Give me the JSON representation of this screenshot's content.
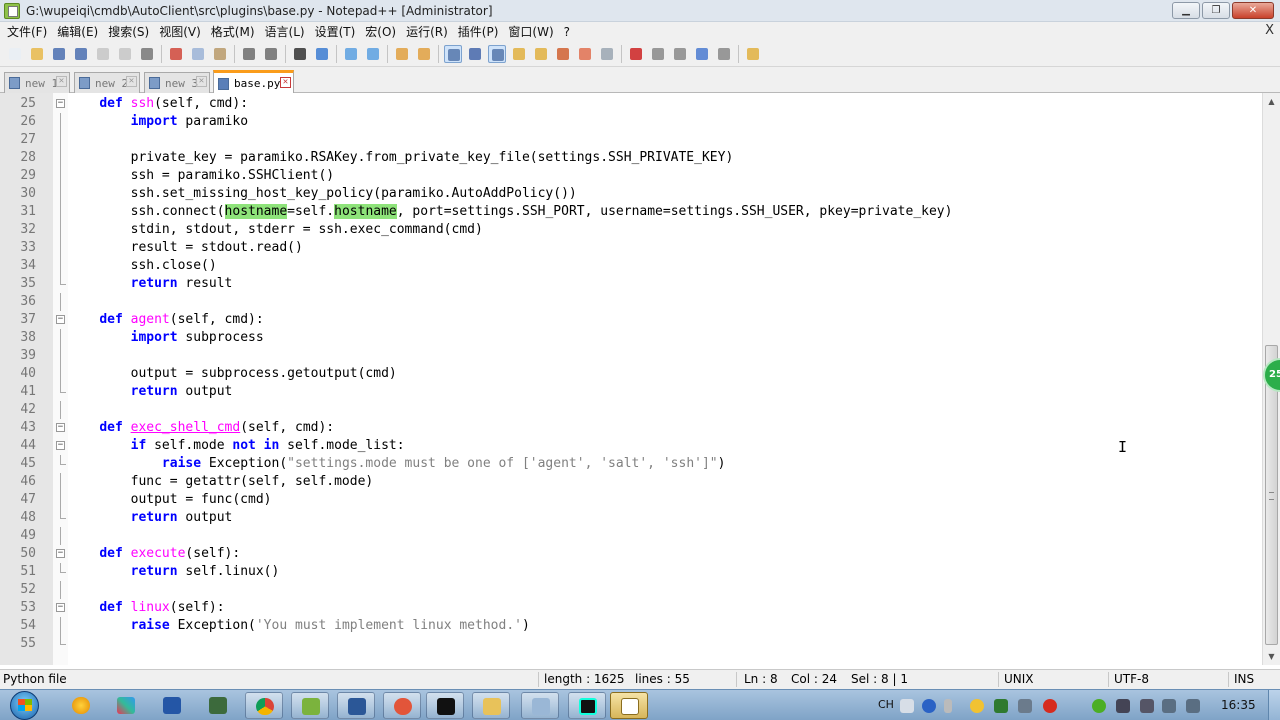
{
  "window": {
    "title": "G:\\wupeiqi\\cmdb\\AutoClient\\src\\plugins\\base.py - Notepad++ [Administrator]",
    "min_label": "▁",
    "max_label": "❐",
    "close_label": "✕"
  },
  "menu": {
    "items": [
      "文件(F)",
      "编辑(E)",
      "搜索(S)",
      "视图(V)",
      "格式(M)",
      "语言(L)",
      "设置(T)",
      "宏(O)",
      "运行(R)",
      "插件(P)",
      "窗口(W)",
      "?"
    ],
    "close_doc": "X"
  },
  "tabs": [
    {
      "label": "new 1",
      "close": "✕"
    },
    {
      "label": "new 2",
      "close": "✕"
    },
    {
      "label": "new 3",
      "close": "✕"
    },
    {
      "label": "base.py",
      "close": "✕",
      "active": true
    }
  ],
  "editor": {
    "fold_open_symbol": "−",
    "first_line": 25,
    "lines": [
      {
        "n": "25",
        "fold": "open",
        "segs": [
          {
            "t": "    "
          },
          {
            "t": "def",
            "c": "k"
          },
          {
            "t": " "
          },
          {
            "t": "ssh",
            "c": "f"
          },
          {
            "t": "(self, cmd):"
          }
        ]
      },
      {
        "n": "26",
        "fold": "line",
        "segs": [
          {
            "t": "        "
          },
          {
            "t": "import",
            "c": "k"
          },
          {
            "t": " paramiko"
          }
        ]
      },
      {
        "n": "27",
        "fold": "line",
        "segs": []
      },
      {
        "n": "28",
        "fold": "line",
        "segs": [
          {
            "t": "        private_key = paramiko.RSAKey.from_private_key_file(settings.SSH_PRIVATE_KEY)"
          }
        ]
      },
      {
        "n": "29",
        "fold": "line",
        "segs": [
          {
            "t": "        ssh = paramiko.SSHClient()"
          }
        ]
      },
      {
        "n": "30",
        "fold": "line",
        "segs": [
          {
            "t": "        ssh.set_missing_host_key_policy(paramiko.AutoAddPolicy())"
          }
        ]
      },
      {
        "n": "31",
        "fold": "line",
        "segs": [
          {
            "t": "        ssh.connect("
          },
          {
            "t": "hostname",
            "c": "hl"
          },
          {
            "t": "=self."
          },
          {
            "t": "hostname",
            "c": "hl"
          },
          {
            "t": ", port=settings.SSH_PORT, username=settings.SSH_USER, pkey=private_key)"
          }
        ]
      },
      {
        "n": "32",
        "fold": "line",
        "segs": [
          {
            "t": "        stdin, stdout, stderr = ssh.exec_command(cmd)"
          }
        ]
      },
      {
        "n": "33",
        "fold": "line",
        "segs": [
          {
            "t": "        result = stdout.read()"
          }
        ]
      },
      {
        "n": "34",
        "fold": "line",
        "segs": [
          {
            "t": "        ssh.close()"
          }
        ]
      },
      {
        "n": "35",
        "fold": "end",
        "segs": [
          {
            "t": "        "
          },
          {
            "t": "return",
            "c": "k"
          },
          {
            "t": " result"
          }
        ]
      },
      {
        "n": "36",
        "fold": "line",
        "segs": []
      },
      {
        "n": "37",
        "fold": "open",
        "segs": [
          {
            "t": "    "
          },
          {
            "t": "def",
            "c": "k"
          },
          {
            "t": " "
          },
          {
            "t": "agent",
            "c": "f"
          },
          {
            "t": "(self, cmd):"
          }
        ]
      },
      {
        "n": "38",
        "fold": "line",
        "segs": [
          {
            "t": "        "
          },
          {
            "t": "import",
            "c": "k"
          },
          {
            "t": " subprocess"
          }
        ]
      },
      {
        "n": "39",
        "fold": "line",
        "segs": []
      },
      {
        "n": "40",
        "fold": "line",
        "segs": [
          {
            "t": "        output = subprocess.getoutput(cmd)"
          }
        ]
      },
      {
        "n": "41",
        "fold": "end",
        "segs": [
          {
            "t": "        "
          },
          {
            "t": "return",
            "c": "k"
          },
          {
            "t": " output"
          }
        ]
      },
      {
        "n": "42",
        "fold": "line",
        "segs": []
      },
      {
        "n": "43",
        "fold": "open",
        "segs": [
          {
            "t": "    "
          },
          {
            "t": "def",
            "c": "k"
          },
          {
            "t": " "
          },
          {
            "t": "exec_shell_cmd",
            "c": "f ul"
          },
          {
            "t": "(self, cmd):"
          }
        ]
      },
      {
        "n": "44",
        "fold": "open",
        "segs": [
          {
            "t": "        "
          },
          {
            "t": "if",
            "c": "k"
          },
          {
            "t": " self.mode "
          },
          {
            "t": "not in",
            "c": "k"
          },
          {
            "t": " self.mode_list:"
          }
        ]
      },
      {
        "n": "45",
        "fold": "end",
        "segs": [
          {
            "t": "            "
          },
          {
            "t": "raise",
            "c": "k"
          },
          {
            "t": " Exception("
          },
          {
            "t": "\"settings.mode must be one of ['agent', 'salt', 'ssh']\"",
            "c": "s"
          },
          {
            "t": ")"
          }
        ]
      },
      {
        "n": "46",
        "fold": "line",
        "segs": [
          {
            "t": "        func = getattr(self, self.mode)"
          }
        ]
      },
      {
        "n": "47",
        "fold": "line",
        "segs": [
          {
            "t": "        output = func(cmd)"
          }
        ]
      },
      {
        "n": "48",
        "fold": "end",
        "segs": [
          {
            "t": "        "
          },
          {
            "t": "return",
            "c": "k"
          },
          {
            "t": " output"
          }
        ]
      },
      {
        "n": "49",
        "fold": "line",
        "segs": []
      },
      {
        "n": "50",
        "fold": "open",
        "segs": [
          {
            "t": "    "
          },
          {
            "t": "def",
            "c": "k"
          },
          {
            "t": " "
          },
          {
            "t": "execute",
            "c": "f"
          },
          {
            "t": "(self):"
          }
        ]
      },
      {
        "n": "51",
        "fold": "end",
        "segs": [
          {
            "t": "        "
          },
          {
            "t": "return",
            "c": "k"
          },
          {
            "t": " self.linux()"
          }
        ]
      },
      {
        "n": "52",
        "fold": "line",
        "segs": []
      },
      {
        "n": "53",
        "fold": "open",
        "segs": [
          {
            "t": "    "
          },
          {
            "t": "def",
            "c": "k"
          },
          {
            "t": " "
          },
          {
            "t": "linux",
            "c": "f"
          },
          {
            "t": "(self):"
          }
        ]
      },
      {
        "n": "54",
        "fold": "line",
        "segs": [
          {
            "t": "        "
          },
          {
            "t": "raise",
            "c": "k"
          },
          {
            "t": " Exception("
          },
          {
            "t": "'You must implement linux method.'",
            "c": "s"
          },
          {
            "t": ")"
          }
        ]
      },
      {
        "n": "55",
        "fold": "end",
        "segs": []
      }
    ]
  },
  "scrollbar": {
    "up_arrow": "▲",
    "down_arrow": "▼",
    "badge_text": "25"
  },
  "status": {
    "language": "Python file",
    "length": "length : 1625",
    "lines": "lines : 55",
    "ln": "Ln : 8",
    "col": "Col : 24",
    "sel": "Sel : 8 | 1",
    "eol": "UNIX",
    "encoding": "UTF-8",
    "mode": "INS"
  },
  "taskbar": {
    "apps": [
      "chrome-ball",
      "pinwheel",
      "save-disk",
      "tools",
      "chrome",
      "notepad",
      "word",
      "fish",
      "cmd",
      "explorer",
      "puzzle",
      "pycharm",
      "picture"
    ],
    "tray_lang": "CH",
    "clock": "16:35"
  },
  "colors": {
    "keyword": "#0000ff",
    "function_name": "#ff00ff",
    "string": "#808080",
    "highlight": "#8ee37a",
    "active_tab_accent": "#fa9c1b"
  }
}
